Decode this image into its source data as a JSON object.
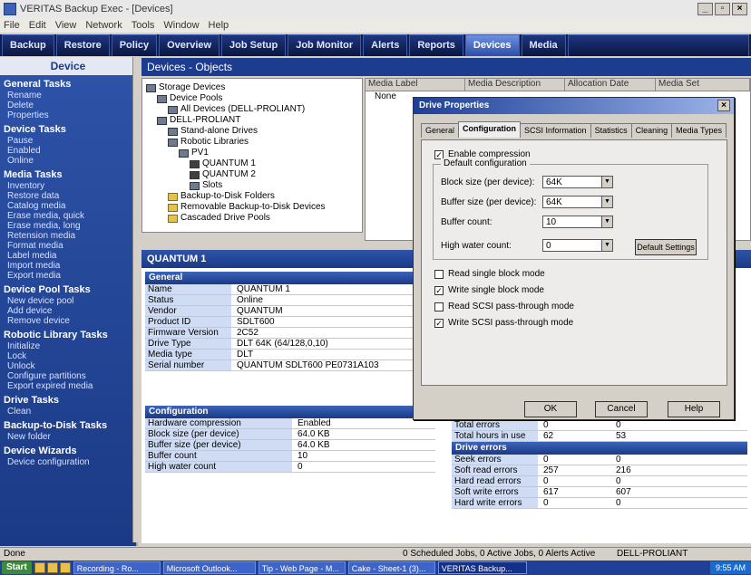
{
  "window": {
    "title": "VERITAS Backup Exec - [Devices]"
  },
  "menu": [
    "File",
    "Edit",
    "View",
    "Network",
    "Tools",
    "Window",
    "Help"
  ],
  "nav": {
    "tabs": [
      "Backup",
      "Restore",
      "Policy",
      "Overview",
      "Job Setup",
      "Job Monitor",
      "Alerts",
      "Reports",
      "Devices",
      "Media"
    ]
  },
  "sidebar": {
    "header": "Device",
    "sections": [
      {
        "title": "General Tasks",
        "items": [
          "Rename",
          "Delete",
          "Properties"
        ]
      },
      {
        "title": "Device Tasks",
        "items": [
          "Pause",
          "Enabled",
          "Online"
        ]
      },
      {
        "title": "Media Tasks",
        "items": [
          "Inventory",
          "Restore data",
          "Catalog media",
          "Erase media, quick",
          "Erase media, long",
          "Retension media",
          "Format media",
          "Label media",
          "Import media",
          "Export media"
        ]
      },
      {
        "title": "Device Pool Tasks",
        "items": [
          "New device pool",
          "Add device",
          "Remove device"
        ]
      },
      {
        "title": "Robotic Library Tasks",
        "items": [
          "Initialize",
          "Lock",
          "Unlock",
          "Configure partitions",
          "Export expired media"
        ]
      },
      {
        "title": "Drive Tasks",
        "items": [
          "Clean"
        ]
      },
      {
        "title": "Backup-to-Disk Tasks",
        "items": [
          "New folder"
        ]
      },
      {
        "title": "Device Wizards",
        "items": [
          "Device configuration"
        ]
      }
    ]
  },
  "view": {
    "title": "Devices - Objects",
    "tree": [
      {
        "label": "Storage Devices",
        "indent": 0,
        "icon": "storage"
      },
      {
        "label": "Device Pools",
        "indent": 1,
        "icon": "pool"
      },
      {
        "label": "All Devices (DELL-PROLIANT)",
        "indent": 2,
        "icon": "pool"
      },
      {
        "label": "DELL-PROLIANT",
        "indent": 1,
        "icon": "server"
      },
      {
        "label": "Stand-alone Drives",
        "indent": 2,
        "icon": "drive"
      },
      {
        "label": "Robotic Libraries",
        "indent": 2,
        "icon": "library"
      },
      {
        "label": "PV1",
        "indent": 3,
        "icon": "library"
      },
      {
        "label": "QUANTUM 1",
        "indent": 4,
        "icon": "tape"
      },
      {
        "label": "QUANTUM 2",
        "indent": 4,
        "icon": "tape"
      },
      {
        "label": "Slots",
        "indent": 4,
        "icon": "slots"
      },
      {
        "label": "Backup-to-Disk Folders",
        "indent": 2,
        "icon": "folder"
      },
      {
        "label": "Removable Backup-to-Disk Devices",
        "indent": 2,
        "icon": "folder"
      },
      {
        "label": "Cascaded Drive Pools",
        "indent": 2,
        "icon": "folder"
      }
    ],
    "list": {
      "headers": [
        "Media Label",
        "Media Description",
        "Allocation Date",
        "Media Set"
      ],
      "rows": [
        "None"
      ]
    }
  },
  "device": {
    "title": "QUANTUM 1",
    "general": {
      "header": "General",
      "rows": [
        {
          "k": "Name",
          "v": "QUANTUM 1"
        },
        {
          "k": "Status",
          "v": "Online"
        },
        {
          "k": "Vendor",
          "v": "QUANTUM"
        },
        {
          "k": "Product ID",
          "v": "SDLT600"
        },
        {
          "k": "Firmware Version",
          "v": "2C52"
        },
        {
          "k": "Drive Type",
          "v": "DLT 64K (64/128,0,10)"
        },
        {
          "k": "Media type",
          "v": "DLT"
        },
        {
          "k": "Serial number",
          "v": "QUANTUM SDLT600 PE0731A103"
        }
      ]
    },
    "config": {
      "header": "Configuration",
      "rows": [
        {
          "k": "Hardware compression",
          "v": "Enabled"
        },
        {
          "k": "Block size (per device)",
          "v": "64.0 KB"
        },
        {
          "k": "Buffer size (per device)",
          "v": "64.0 KB"
        },
        {
          "k": "Buffer count",
          "v": "10"
        },
        {
          "k": "High water count",
          "v": "0"
        }
      ]
    },
    "stats": {
      "rows": [
        {
          "k": "Total errors",
          "v1": "0",
          "v2": "0"
        },
        {
          "k": "Total hours in use",
          "v1": "62",
          "v2": "53"
        }
      ]
    },
    "errors": {
      "header": "Drive errors",
      "rows": [
        {
          "k": "Seek errors",
          "v1": "0",
          "v2": "0"
        },
        {
          "k": "Soft read errors",
          "v1": "257",
          "v2": "216"
        },
        {
          "k": "Hard read errors",
          "v1": "0",
          "v2": "0"
        },
        {
          "k": "Soft write errors",
          "v1": "617",
          "v2": "607"
        },
        {
          "k": "Hard write errors",
          "v1": "0",
          "v2": "0"
        }
      ]
    }
  },
  "dialog": {
    "title": "Drive Properties",
    "tabs": [
      "General",
      "Configuration",
      "SCSI Information",
      "Statistics",
      "Cleaning",
      "Media Types"
    ],
    "active_tab": "Configuration",
    "enable_compression": "Enable compression",
    "group_title": "Default configuration",
    "fields": [
      {
        "label": "Block size (per device):",
        "value": "64K"
      },
      {
        "label": "Buffer size (per device):",
        "value": "64K"
      },
      {
        "label": "Buffer count:",
        "value": "10"
      },
      {
        "label": "High water count:",
        "value": "0"
      }
    ],
    "default_settings": "Default Settings",
    "checks": [
      {
        "label": "Read single block mode",
        "checked": false
      },
      {
        "label": "Write single block mode",
        "checked": true
      },
      {
        "label": "Read SCSI pass-through mode",
        "checked": false
      },
      {
        "label": "Write SCSI pass-through mode",
        "checked": true
      }
    ],
    "buttons": {
      "ok": "OK",
      "cancel": "Cancel",
      "help": "Help"
    }
  },
  "status": {
    "left": "Done",
    "center": "0 Scheduled Jobs, 0 Active Jobs, 0 Alerts Active",
    "right": "DELL-PROLIANT"
  },
  "taskbar": {
    "start": "Start",
    "items": [
      "Recording - Ro...",
      "Microsoft Outlook...",
      "Tip - Web Page - M...",
      "Cake - Sheet-1 (3)...",
      "VERITAS Backup..."
    ],
    "tray": "9:55 AM"
  }
}
